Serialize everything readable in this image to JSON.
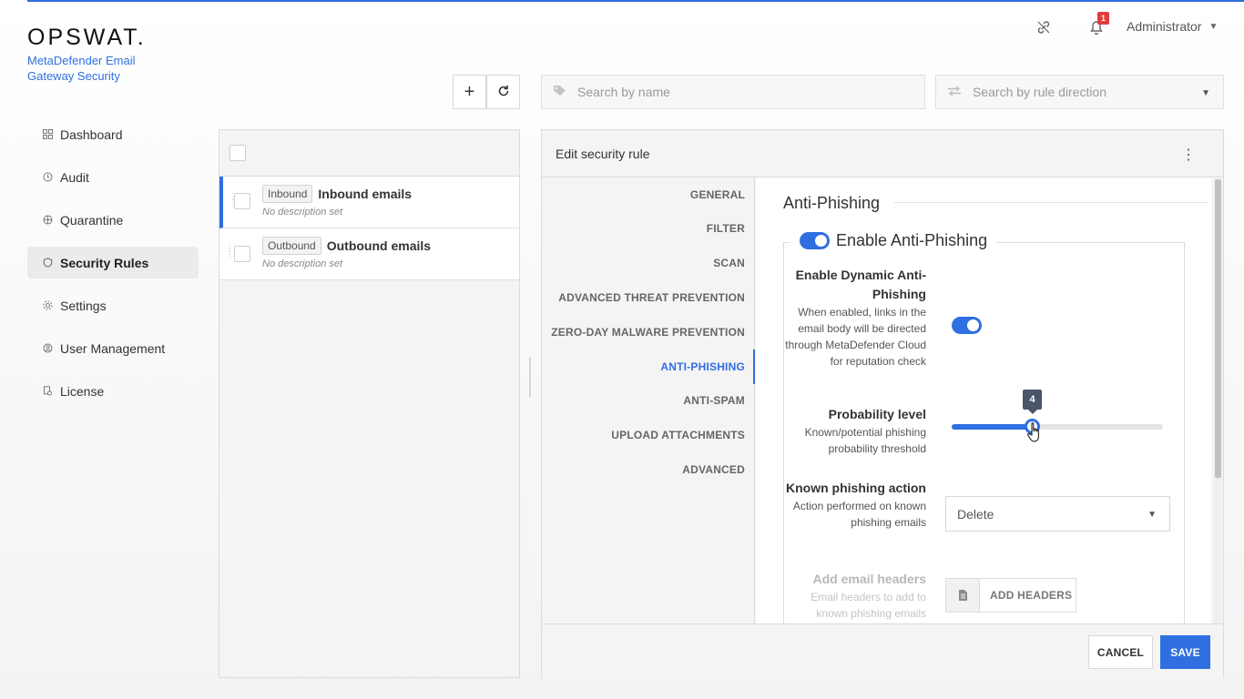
{
  "app": {
    "brand": "OPSWAT.",
    "product": "MetaDefender Email Gateway Security"
  },
  "header": {
    "notification_count": "1",
    "user": "Administrator"
  },
  "sidebar": {
    "items": [
      {
        "label": "Dashboard",
        "icon": "dashboard-icon"
      },
      {
        "label": "Audit",
        "icon": "audit-icon"
      },
      {
        "label": "Quarantine",
        "icon": "quarantine-icon"
      },
      {
        "label": "Security Rules",
        "icon": "shield-icon",
        "active": true
      },
      {
        "label": "Settings",
        "icon": "gear-icon"
      },
      {
        "label": "User Management",
        "icon": "user-icon"
      },
      {
        "label": "License",
        "icon": "license-icon"
      }
    ]
  },
  "toolbar": {
    "search_name_placeholder": "Search by name",
    "search_direction_placeholder": "Search by rule direction"
  },
  "rules": [
    {
      "tag": "Inbound",
      "name": "Inbound emails",
      "desc": "No description set",
      "selected": true
    },
    {
      "tag": "Outbound",
      "name": "Outbound emails",
      "desc": "No description set",
      "selected": false
    }
  ],
  "editor": {
    "title": "Edit security rule",
    "tabs": [
      "GENERAL",
      "FILTER",
      "SCAN",
      "ADVANCED THREAT PREVENTION",
      "ZERO-DAY MALWARE PREVENTION",
      "ANTI-PHISHING",
      "ANTI-SPAM",
      "UPLOAD ATTACHMENTS",
      "ADVANCED"
    ],
    "active_tab": "ANTI-PHISHING",
    "section_title": "Anti-Phishing",
    "enable_label": "Enable Anti-Phishing",
    "enable_on": true,
    "dynamic": {
      "title": "Enable Dynamic Anti-Phishing",
      "desc": "When enabled, links in the email body will be directed through MetaDefender Cloud for reputation check",
      "on": true
    },
    "probability": {
      "title": "Probability level",
      "desc": "Known/potential phishing probability threshold",
      "value": "4",
      "fraction": 0.38
    },
    "known_action": {
      "title": "Known phishing action",
      "desc": "Action performed on known phishing emails",
      "value": "Delete"
    },
    "headers": {
      "title": "Add email headers",
      "desc": "Email headers to add to known phishing emails",
      "button": "ADD HEADERS"
    },
    "cancel_label": "CANCEL",
    "save_label": "SAVE"
  },
  "colors": {
    "accent": "#2f6fe0",
    "badge": "#e23b3b"
  }
}
